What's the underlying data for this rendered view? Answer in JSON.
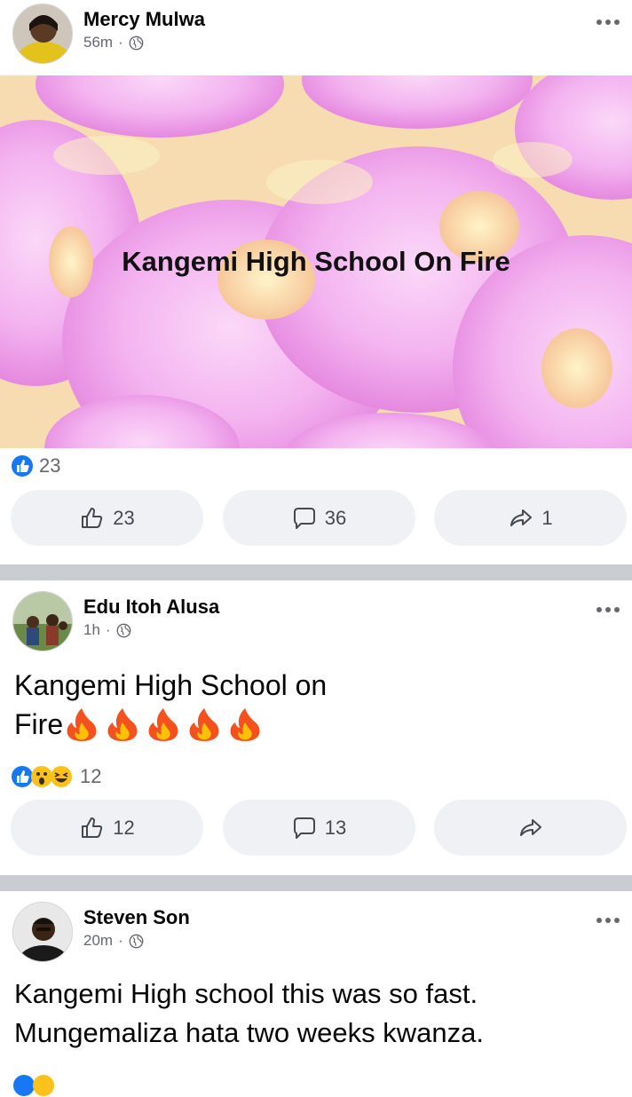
{
  "posts": [
    {
      "author": "Mercy Mulwa",
      "time": "56m",
      "separator": "·",
      "text": "Kangemi High School On Fire",
      "reaction_count": "23",
      "like_count": "23",
      "comment_count": "36",
      "share_count": "1",
      "background_colors": [
        "#f7c9f5",
        "#f6e7a8",
        "#ea8be6"
      ]
    },
    {
      "author": "Edu Itoh Alusa",
      "time": "1h",
      "separator": "·",
      "text": "Kangemi High School on Fire🔥🔥🔥🔥🔥",
      "text_line1": "Kangemi High School on",
      "text_line2": "Fire",
      "reaction_count": "12",
      "like_count": "12",
      "comment_count": "13",
      "share_count": ""
    },
    {
      "author": "Steven Son",
      "time": "20m",
      "separator": "·",
      "text_line1": "Kangemi High school this was so fast.",
      "text_line2": "Mungemaliza hata two weeks kwanza."
    }
  ],
  "colors": {
    "like_blue": "#1877f2",
    "button_bg": "#eff1f4",
    "divider": "#c9ccd1",
    "secondary_text": "#65676b"
  },
  "icons": [
    "globe-icon",
    "more-icon",
    "like-icon",
    "comment-icon",
    "share-icon",
    "fire-emoji",
    "wow-emoji",
    "haha-emoji"
  ]
}
